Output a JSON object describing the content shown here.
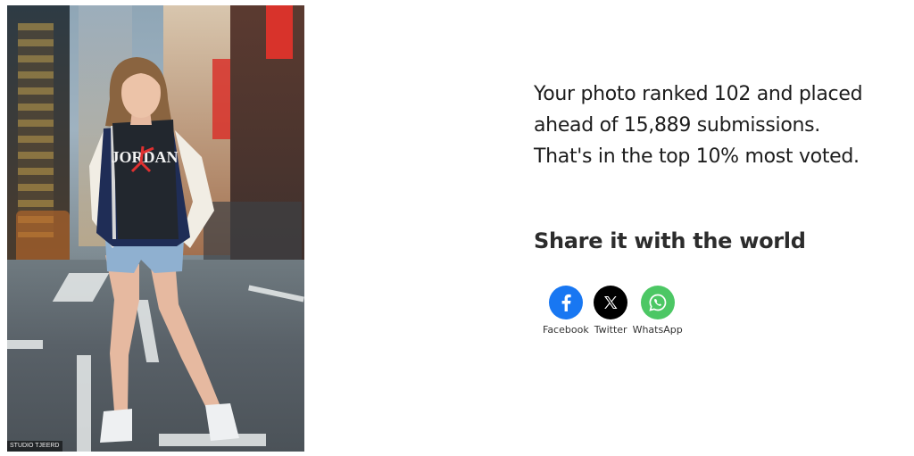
{
  "photo": {
    "credit": "STUDIO TJEERD",
    "shirt_text": "JORDAN"
  },
  "result": {
    "line1": "Your photo ranked 102 and placed",
    "line2": "ahead of 15,889 submissions.",
    "line3": "That's in the top 10% most voted."
  },
  "share": {
    "title": "Share it with the world",
    "items": [
      {
        "label": "Facebook",
        "icon": "facebook-icon",
        "color": "#1877f2"
      },
      {
        "label": "Twitter",
        "icon": "x-icon",
        "color": "#000000"
      },
      {
        "label": "WhatsApp",
        "icon": "whatsapp-icon",
        "color": "#4cc764"
      }
    ]
  }
}
